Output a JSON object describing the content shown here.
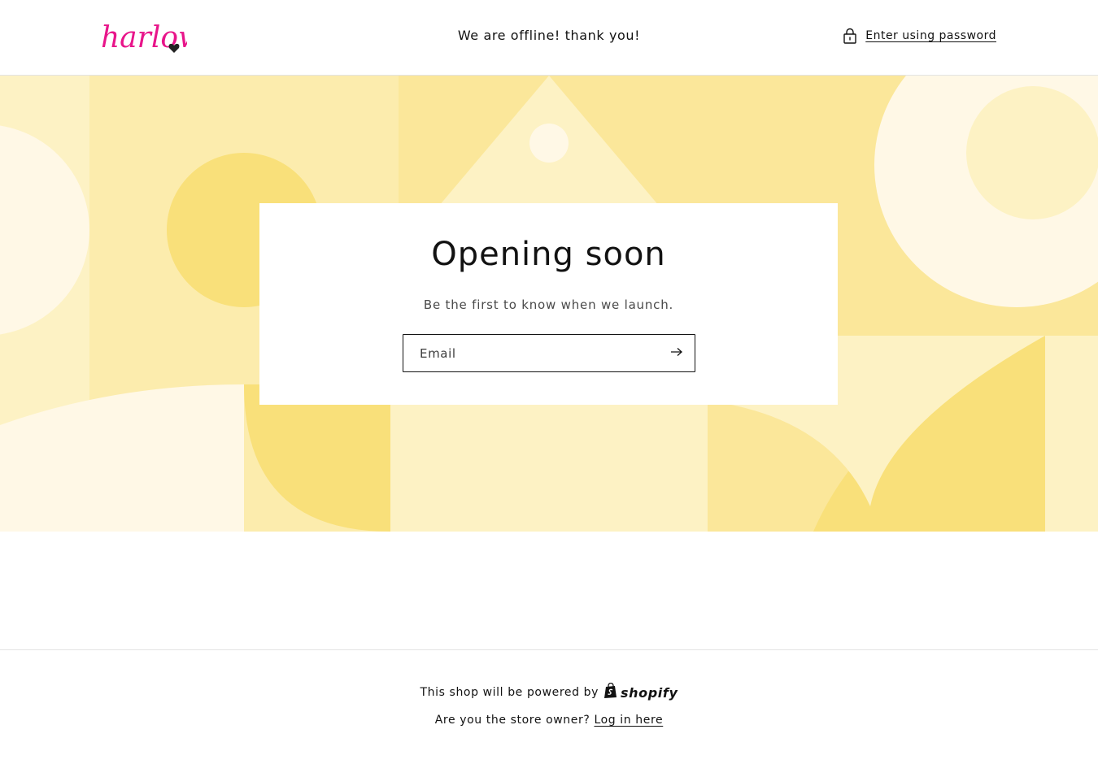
{
  "header": {
    "logo_text": "harlow",
    "message": "We are offline! thank you!",
    "password_link": "Enter using password"
  },
  "banner": {
    "colors": {
      "light": "#fdf2c4",
      "mid": "#fbe79a",
      "strong": "#f9e07a",
      "cream": "#fff8e6"
    }
  },
  "card": {
    "title": "Opening soon",
    "subtitle": "Be the first to know when we launch.",
    "email_placeholder": "Email"
  },
  "footer": {
    "powered_text": "This shop will be powered by",
    "shopify_text": "shopify",
    "owner_text": "Are you the store owner?",
    "login_link": "Log in here"
  },
  "icons": [
    "lock-icon",
    "arrow-right-icon",
    "shopify-bag-icon"
  ],
  "colors": {
    "accent_logo": "#e8158a",
    "text": "#121212"
  }
}
